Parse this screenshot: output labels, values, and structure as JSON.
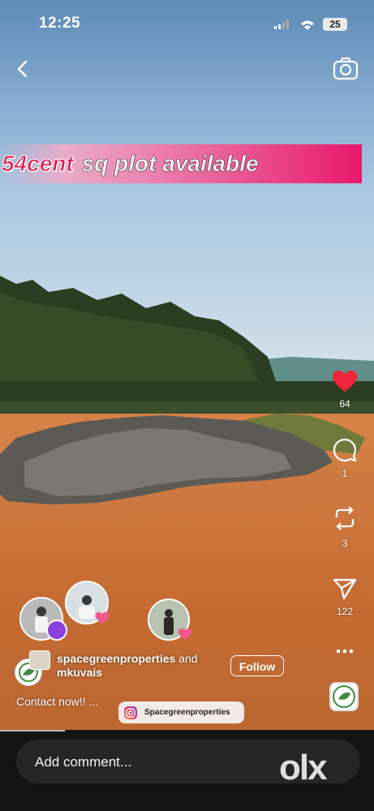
{
  "status_bar": {
    "time": "12:25",
    "battery": "25"
  },
  "banner": {
    "part1": "54cent",
    "part2": "sq plot available"
  },
  "actions": {
    "likes": "64",
    "comments": "1",
    "reposts": "3",
    "shares": "122"
  },
  "author": {
    "name": "spacegreenproperties",
    "connector": "and",
    "collaborator": "mkuvais"
  },
  "follow_label": "Follow",
  "caption": "Contact now!! ...",
  "instagram_tag": "Spacegreenproperties",
  "comment_placeholder": "Add comment...",
  "watermark": "olx",
  "colors": {
    "like": "#f0243a",
    "banner_accent": "#e8196a",
    "bottom_bar": "#141414"
  }
}
